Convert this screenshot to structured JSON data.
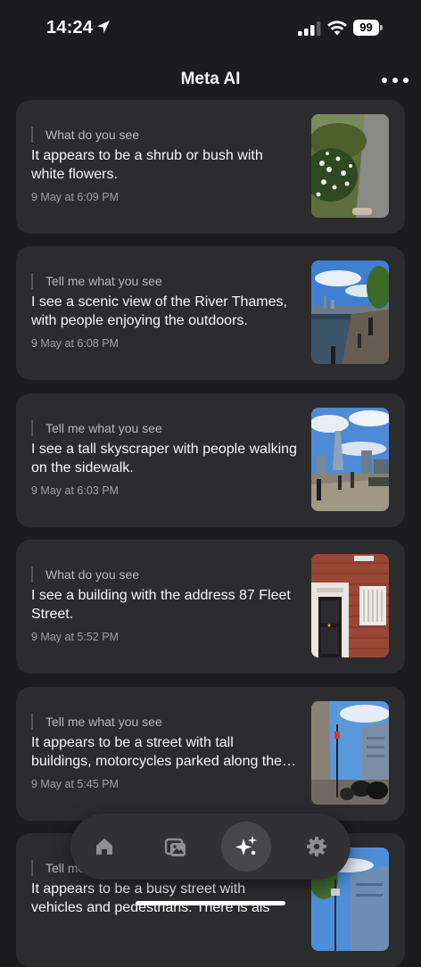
{
  "status_bar": {
    "time": "14:24",
    "battery": "99"
  },
  "header": {
    "title": "Meta AI"
  },
  "entries": [
    {
      "prompt": "What do you see",
      "answer": "It appears to be a shrub or bush with white flowers.",
      "timestamp": "9 May at 6:09 PM"
    },
    {
      "prompt": "Tell me what you see",
      "answer": "I see a scenic view of the River Thames, with people enjoying the outdoors.",
      "timestamp": "9 May at 6:08 PM"
    },
    {
      "prompt": "Tell me what you see",
      "answer": "I see a tall skyscraper with people walking on the sidewalk.",
      "timestamp": "9 May at 6:03 PM"
    },
    {
      "prompt": "What do you see",
      "answer": "I see a building with the address 87 Fleet Street.",
      "timestamp": "9 May at 5:52 PM"
    },
    {
      "prompt": "Tell me what you see",
      "answer": "It appears to be a street with tall buildings, motorcycles parked along the side.",
      "timestamp": "9 May at 5:45 PM"
    },
    {
      "prompt": "Tell me what you see",
      "answer": "It appears to be a busy street with vehicles and pedestrians. There is als",
      "timestamp": ""
    }
  ],
  "nav": {
    "items": [
      {
        "icon": "home-icon"
      },
      {
        "icon": "gallery-icon"
      },
      {
        "icon": "meta-ai-sparkle-icon",
        "active": true
      },
      {
        "icon": "settings-gear-icon"
      }
    ]
  }
}
